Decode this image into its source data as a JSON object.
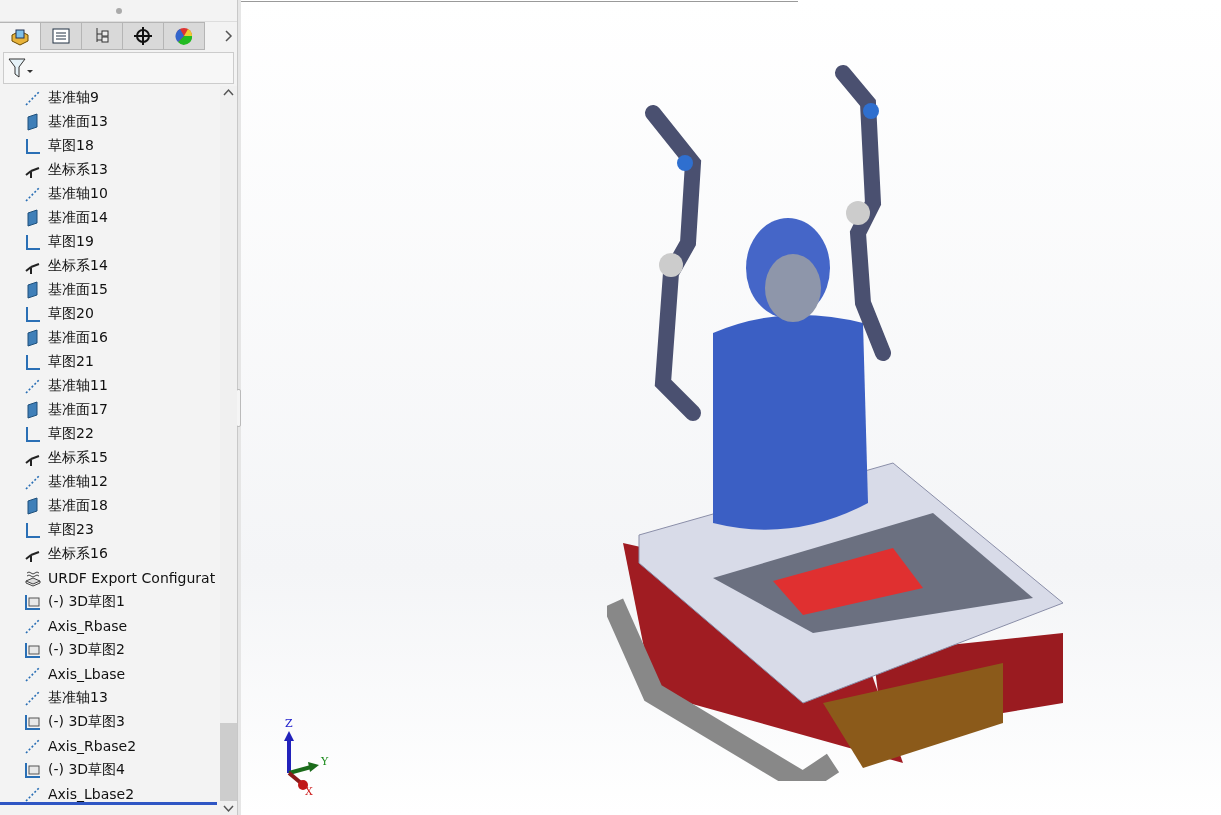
{
  "panel_tabs": [
    {
      "kind": "feature",
      "selected": true
    },
    {
      "kind": "property",
      "selected": false
    },
    {
      "kind": "config",
      "selected": false
    },
    {
      "kind": "dim",
      "selected": false
    },
    {
      "kind": "display",
      "selected": false
    }
  ],
  "tree": {
    "items": [
      {
        "kind": "axis",
        "label": "基准轴9"
      },
      {
        "kind": "plane",
        "label": "基准面13"
      },
      {
        "kind": "sketch",
        "label": "草图18"
      },
      {
        "kind": "coord",
        "label": "坐标系13"
      },
      {
        "kind": "axis",
        "label": "基准轴10"
      },
      {
        "kind": "plane",
        "label": "基准面14"
      },
      {
        "kind": "sketch",
        "label": "草图19"
      },
      {
        "kind": "coord",
        "label": "坐标系14"
      },
      {
        "kind": "plane",
        "label": "基准面15"
      },
      {
        "kind": "sketch",
        "label": "草图20"
      },
      {
        "kind": "plane",
        "label": "基准面16"
      },
      {
        "kind": "sketch",
        "label": "草图21"
      },
      {
        "kind": "axis",
        "label": "基准轴11"
      },
      {
        "kind": "plane",
        "label": "基准面17"
      },
      {
        "kind": "sketch",
        "label": "草图22"
      },
      {
        "kind": "coord",
        "label": "坐标系15"
      },
      {
        "kind": "axis",
        "label": "基准轴12"
      },
      {
        "kind": "plane",
        "label": "基准面18"
      },
      {
        "kind": "sketch",
        "label": "草图23"
      },
      {
        "kind": "coord",
        "label": "坐标系16"
      },
      {
        "kind": "urdf",
        "label": "URDF Export Configurat"
      },
      {
        "kind": "sketch3d",
        "label": "(-) 3D草图1"
      },
      {
        "kind": "axis",
        "label": "Axis_Rbase"
      },
      {
        "kind": "sketch3d",
        "label": "(-) 3D草图2"
      },
      {
        "kind": "axis",
        "label": "Axis_Lbase"
      },
      {
        "kind": "axis",
        "label": "基准轴13"
      },
      {
        "kind": "sketch3d",
        "label": "(-) 3D草图3"
      },
      {
        "kind": "axis",
        "label": "Axis_Rbase2"
      },
      {
        "kind": "sketch3d",
        "label": "(-) 3D草图4"
      },
      {
        "kind": "axis",
        "label": "Axis_Lbase2"
      }
    ]
  },
  "triad": {
    "z": "Z",
    "y": "Y",
    "x": "X"
  }
}
